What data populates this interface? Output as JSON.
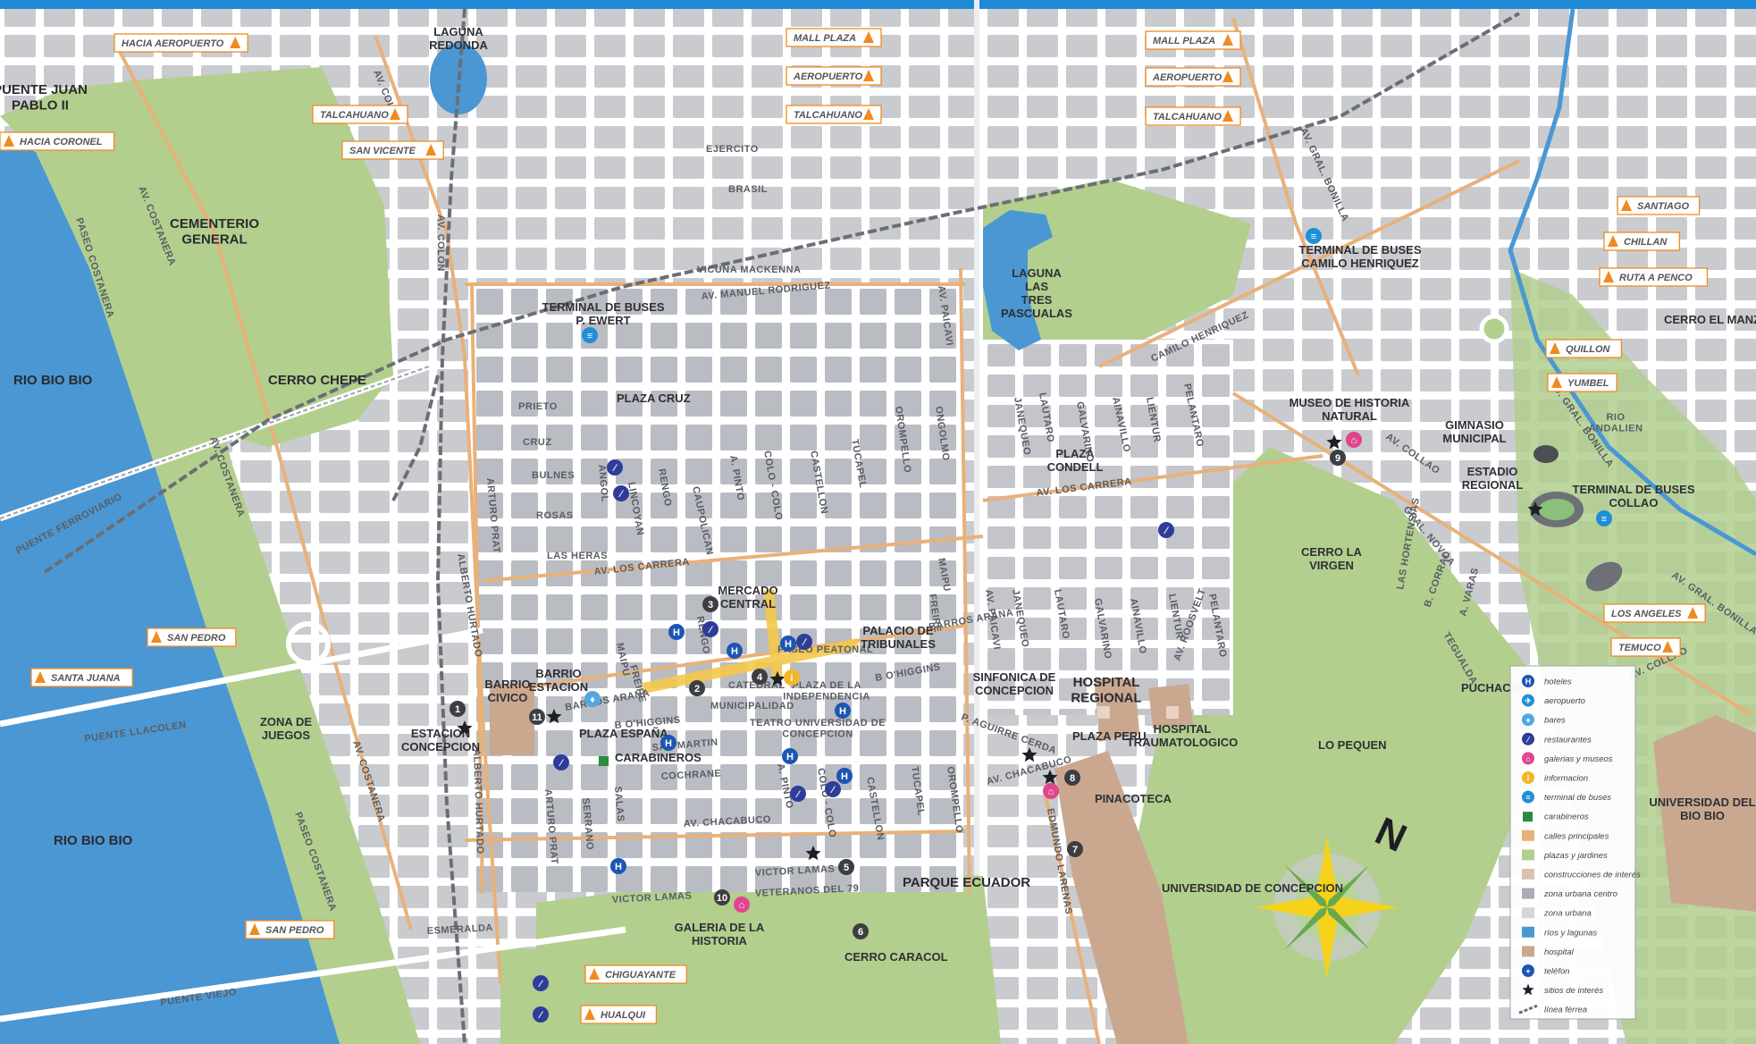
{
  "colors": {
    "water": "#4a97d3",
    "park": "#b2cf8e",
    "urban": "#d4d6da",
    "block": "#b9bcc2",
    "street": "#ffffff",
    "main_street": "#e8b17a",
    "hospital": "#caa88f",
    "accent": "#f08a21",
    "rail": "#6b6e74"
  },
  "destinations": [
    {
      "label": "HACIA AEROPUERTO"
    },
    {
      "label": "HACIA CORONEL"
    },
    {
      "label": "TALCAHUANO"
    },
    {
      "label": "SAN VICENTE"
    },
    {
      "label": "MALL PLAZA"
    },
    {
      "label": "AEROPUERTO"
    },
    {
      "label": "TALCAHUANO"
    },
    {
      "label": "MALL PLAZA"
    },
    {
      "label": "AEROPUERTO"
    },
    {
      "label": "TALCAHUANO"
    },
    {
      "label": "SANTIAGO"
    },
    {
      "label": "CHILLAN"
    },
    {
      "label": "RUTA A PENCO"
    },
    {
      "label": "QUILLON"
    },
    {
      "label": "YUMBEL"
    },
    {
      "label": "LOS ANGELES"
    },
    {
      "label": "TEMUCO"
    },
    {
      "label": "SAN PEDRO"
    },
    {
      "label": "SANTA JUANA"
    },
    {
      "label": "SAN PEDRO"
    },
    {
      "label": "CHIGUAYANTE"
    },
    {
      "label": "HUALQUI"
    }
  ],
  "water_labels": [
    "RIO BIO BIO",
    "RIO BIO BIO",
    "LAGUNA REDONDA",
    "LAGUNA LAS TRES PASCUALAS",
    "RIO ANDALIEN"
  ],
  "places": {
    "puente_jp": "PUENTE JUAN PABLO II",
    "cementerio": "CEMENTERIO GENERAL",
    "cerro_chepe": "CERRO CHEPE",
    "zona_juegos": "ZONA DE JUEGOS",
    "plaza_cruz": "PLAZA CRUZ",
    "terminal_ewert": "TERMINAL DE BUSES P. EWERT",
    "barrio_civico": "BARRIO CIVICO",
    "estacion": "ESTACION CONCEPCION",
    "barrio_estacion": "BARRIO ESTACION",
    "plaza_espana": "PLAZA ESPAÑA",
    "carabineros": "CARABINEROS",
    "mercado": "MERCADO CENTRAL",
    "catedral": "CATEDRAL",
    "municipalidad": "MUNICIPALIDAD",
    "plaza_indep": "PLAZA DE LA INDEPENDENCIA",
    "paseo_peatonal": "PASEO PEATONAL",
    "palacio": "PALACIO DE TRIBUNALES",
    "teatro": "TEATRO UNIVERSIDAD DE CONCEPCION",
    "parque_ecuador": "PARQUE ECUADOR",
    "galeria": "GALERIA DE LA HISTORIA",
    "cerro_caracol": "CERRO CARACOL",
    "sinfonica": "SINFONICA DE CONCEPCION",
    "plaza_peru": "PLAZA PERU",
    "pinacoteca": "PINACOTECA",
    "hospital_regional": "HOSPITAL REGIONAL",
    "traumatologico": "HOSPITAL TRAUMATOLOGICO",
    "udec": "UNIVERSIDAD DE CONCEPCION",
    "plaza_condell": "PLAZA CONDELL",
    "terminal_camilo": "TERMINAL DE BUSES CAMILO HENRIQUEZ",
    "museo": "MUSEO DE HISTORIA NATURAL",
    "cerro_virgen": "CERRO LA VIRGEN",
    "lo_pequen": "LO PEQUEN",
    "puchacay": "PUCHACAY",
    "gimnasio": "GIMNASIO MUNICIPAL",
    "estadio": "ESTADIO REGIONAL",
    "terminal_collao": "TERMINAL DE BUSES COLLAO",
    "cerro_manzano": "CERRO EL MANZANO",
    "ubiobio": "UNIVERSIDAD DEL BIO BIO"
  },
  "streets": [
    "AV. COLON",
    "AV. COLON",
    "AV. COSTANERA",
    "AV. COSTANERA",
    "AV. COSTANERA",
    "PASEO COSTANERA",
    "PASEO COSTANERA",
    "PUENTE FERROVIARIO",
    "PUENTE LLACOLEN",
    "PUENTE VIEJO",
    "EJERCITO",
    "BRASIL",
    "VICUÑA MACKENNA",
    "AV. MANUEL RODRIGUEZ",
    "PRIETO",
    "CRUZ",
    "BULNES",
    "ROSAS",
    "LAS HERAS",
    "AV. LOS CARRERA",
    "BARROS ARANA",
    "B O'HIGGINS",
    "SAN MARTIN",
    "COCHRANE",
    "AV. CHACABUCO",
    "VICTOR LAMAS",
    "VICTOR LAMAS",
    "VETERANOS DEL 79",
    "ESMERALDA",
    "ALBERTO HURTADO",
    "ALBERTO HURTADO",
    "ARTURO PRAT",
    "ARTURO PRAT",
    "ANGOL",
    "LINCOYAN",
    "RENGO",
    "CAUPOLICAN",
    "A. PINTO",
    "COLO - COLO",
    "CASTELLON",
    "TUCAPEL",
    "OROMPELLO",
    "ONGOLMO",
    "MAIPU",
    "FREIRE",
    "BARROS ARANA",
    "B O'HIGGINS",
    "SERRANO",
    "SALAS",
    "RENGO",
    "MAIPU",
    "FREIRE",
    "A. PINTO",
    "COLO - COLO",
    "CASTELLON",
    "TUCAPEL",
    "OROMPELLO",
    "AV. PAICAVI",
    "AV. PAICAVI",
    "AV. LOS CARRERA",
    "JANEQUEO",
    "LAUTARO",
    "GALVARINO",
    "AINAVILLO",
    "LIENTUR",
    "PELANTARO",
    "JANEQUEO",
    "LAUTARO",
    "GALVARINO",
    "AINAVILLO",
    "LIENTUR",
    "PELANTARO",
    "CAMILO HENRIQUEZ",
    "AV. GRAL. BONILLA",
    "AV. GRAL. BONILLA",
    "AV. GRAL. BONILLA",
    "AV. COLLAO",
    "AV. COLLAO",
    "GRAL. NOVOA",
    "LAS HORTENSIAS",
    "B. CORRAL",
    "A. VARAS",
    "TEGUALDA",
    "AV. ROOSVELT",
    "AV. CHACABUCO",
    "EDMUNDO LARENAS",
    "P. AGUIRRE CERDA"
  ],
  "sites": [
    "1",
    "2",
    "3",
    "4",
    "5",
    "6",
    "7",
    "8",
    "9",
    "10",
    "11"
  ],
  "compass": "N",
  "legend": [
    {
      "label": "hoteles",
      "icon": "hotel-icon"
    },
    {
      "label": "aeropuerto",
      "icon": "airport-icon"
    },
    {
      "label": "bares",
      "icon": "bar-icon"
    },
    {
      "label": "restaurantes",
      "icon": "restaurant-icon"
    },
    {
      "label": "galerias y museos",
      "icon": "museum-icon"
    },
    {
      "label": "informacion",
      "icon": "info-icon"
    },
    {
      "label": "terminal de buses",
      "icon": "bus-terminal-icon"
    },
    {
      "label": "carabineros",
      "icon": "police-icon"
    },
    {
      "label": "calles principales",
      "icon": "main-street-swatch"
    },
    {
      "label": "plazas y jardines",
      "icon": "park-swatch"
    },
    {
      "label": "construcciones de interés",
      "icon": "building-swatch"
    },
    {
      "label": "zona urbana centro",
      "icon": "center-swatch"
    },
    {
      "label": "zona urbana",
      "icon": "urban-swatch"
    },
    {
      "label": "ríos y lagunas",
      "icon": "water-swatch"
    },
    {
      "label": "hospital",
      "icon": "hospital-swatch"
    },
    {
      "label": "teléfon",
      "icon": "phone-icon"
    },
    {
      "label": "sitios de interés",
      "icon": "star-icon"
    },
    {
      "label": "línea férrea",
      "icon": "rail-swatch"
    }
  ]
}
